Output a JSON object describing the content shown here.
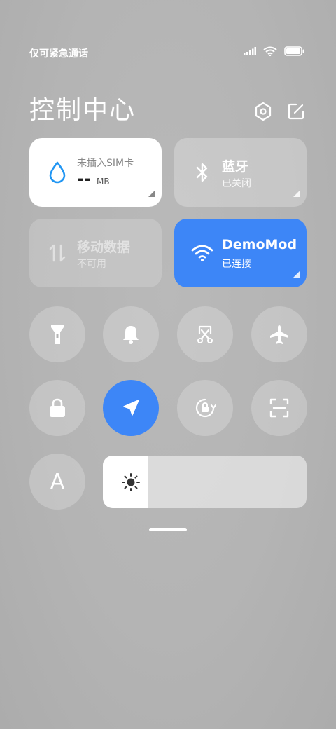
{
  "status_bar": {
    "text": "仅可紧急通话"
  },
  "header": {
    "title": "控制中心",
    "settings_icon": "settings-hex-icon",
    "edit_icon": "edit-icon"
  },
  "tiles": {
    "data": {
      "title": "未插入SIM卡",
      "value": "--",
      "unit": "MB"
    },
    "bluetooth": {
      "title": "蓝牙",
      "status": "已关闭"
    },
    "mobile_data": {
      "title": "移动数据",
      "status": "不可用"
    },
    "wifi": {
      "title": "DemoMod",
      "status": "已连接"
    }
  },
  "toggles_row1": [
    "flashlight-icon",
    "bell-icon",
    "screenshot-icon",
    "airplane-icon"
  ],
  "toggles_row2": [
    "lock-icon",
    "location-icon",
    "rotation-lock-icon",
    "scan-icon"
  ],
  "auto_brightness": {
    "label": "A"
  },
  "brightness": {
    "level": 0.22
  },
  "colors": {
    "accent": "#3d86f7",
    "tile_white": "#ffffff",
    "drop_blue": "#2196f3"
  }
}
